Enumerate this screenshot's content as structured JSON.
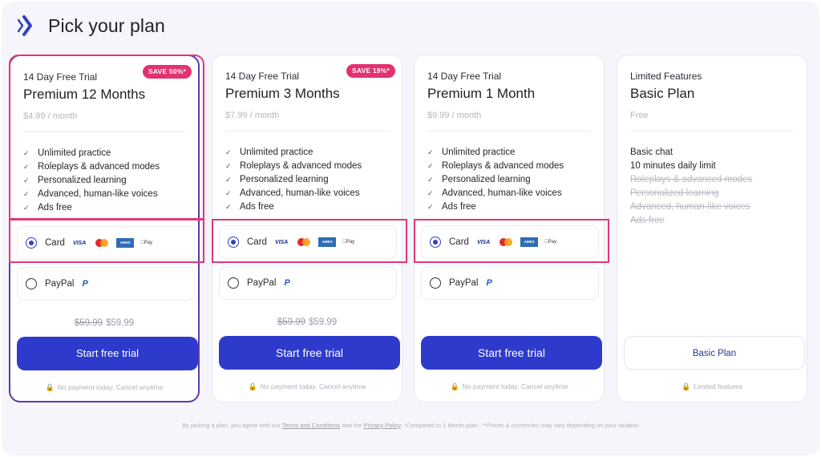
{
  "header": {
    "title": "Pick your plan",
    "logo_icon": "brand-chevrons-icon"
  },
  "colors": {
    "accent": "#2e3acb",
    "badge": "#e2326f",
    "selected_border": "#5c3ab0",
    "highlight": "#e0377a"
  },
  "plans": [
    {
      "trial_label": "14 Day Free Trial",
      "name": "Premium 12 Months",
      "price_per_month": "$4.99 / month",
      "badge": "SAVE 50%*",
      "selected": true,
      "features": [
        "Unlimited practice",
        "Roleplays & advanced modes",
        "Personalized learning",
        "Advanced, human-like voices",
        "Ads free"
      ],
      "payment": {
        "card_label": "Card",
        "paypal_label": "PayPal",
        "selected": "card",
        "card_brands": [
          "VISA",
          "Mastercard",
          "AMEX",
          "Apple Pay"
        ]
      },
      "old_total": "$59.99",
      "total": "$59.99",
      "cta": "Start free trial",
      "note": "No payment today. Cancel anytime"
    },
    {
      "trial_label": "14 Day Free Trial",
      "name": "Premium 3 Months",
      "price_per_month": "$7.99 / month",
      "badge": "SAVE 19%*",
      "selected": false,
      "features": [
        "Unlimited practice",
        "Roleplays & advanced modes",
        "Personalized learning",
        "Advanced, human-like voices",
        "Ads free"
      ],
      "payment": {
        "card_label": "Card",
        "paypal_label": "PayPal",
        "selected": "card",
        "card_brands": [
          "VISA",
          "Mastercard",
          "AMEX",
          "Apple Pay"
        ]
      },
      "old_total": "$59.99",
      "total": "$59.99",
      "cta": "Start free trial",
      "note": "No payment today. Cancel anytime"
    },
    {
      "trial_label": "14 Day Free Trial",
      "name": "Premium 1 Month",
      "price_per_month": "$9.99 / month",
      "selected": false,
      "features": [
        "Unlimited practice",
        "Roleplays & advanced modes",
        "Personalized learning",
        "Advanced, human-like voices",
        "Ads free"
      ],
      "payment": {
        "card_label": "Card",
        "paypal_label": "PayPal",
        "selected": "card",
        "card_brands": [
          "VISA",
          "Mastercard",
          "AMEX",
          "Apple Pay"
        ]
      },
      "cta": "Start free trial",
      "note": "No payment today. Cancel anytime"
    },
    {
      "trial_label": "Limited Features",
      "name": "Basic Plan",
      "price_per_month": "Free",
      "selected": false,
      "features_included": [
        "Basic chat",
        "10 minutes daily limit"
      ],
      "features_excluded": [
        "Roleplays & advanced modes",
        "Personalized learning",
        "Advanced, human-like voices",
        "Ads free"
      ],
      "cta": "Basic Plan",
      "note": "Limited features"
    }
  ],
  "brand_text": {
    "visa": "VISA",
    "amex": "AMEX",
    "apple_pay": "Pay",
    "paypal_glyph": "P",
    "check": "✓",
    "lock": "🔒"
  },
  "footer": {
    "prefix": "By picking a plan, you agree with our ",
    "terms_link": "Terms and Conditions",
    "middle": " and the ",
    "privacy_link": "Privacy Policy",
    "suffix": ". *Compared to 1 Month plan . **Prices & currencies may vary depending on your location"
  }
}
